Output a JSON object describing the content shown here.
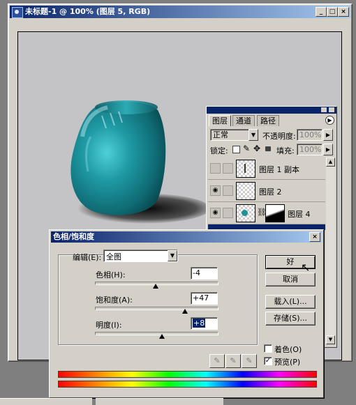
{
  "document": {
    "title": "未标题-1 @ 100% (图层 5, RGB)",
    "controls": {
      "minimize": "_",
      "maximize": "□",
      "close": "×"
    }
  },
  "layers_panel": {
    "tabs": [
      "图层",
      "通道",
      "路径"
    ],
    "blend_mode": "正常",
    "opacity_label": "不透明度:",
    "opacity_value": "100%",
    "lock_label": "锁定:",
    "fill_label": "填充:",
    "fill_value": "100%",
    "layers": [
      {
        "name": "图层 1 副本",
        "visible": false
      },
      {
        "name": "图层 2",
        "visible": true
      },
      {
        "name": "图层 4",
        "visible": true
      }
    ]
  },
  "dialog": {
    "title": "色相/饱和度",
    "edit_label": "编辑(E):",
    "edit_value": "全图",
    "hue_label": "色相(H):",
    "hue_value": "-4",
    "hue_position": 0.49,
    "saturation_label": "饱和度(A):",
    "saturation_value": "+47",
    "saturation_position": 0.73,
    "lightness_label": "明度(I):",
    "lightness_value": "+8",
    "lightness_position": 0.54,
    "buttons": {
      "ok": "好",
      "cancel": "取消",
      "load": "载入(L)...",
      "save": "存储(S)..."
    },
    "colorize_label": "着色(O)",
    "colorize_checked": false,
    "preview_label": "预览(P)",
    "preview_checked": true
  },
  "colors": {
    "title_bar_start": "#0a246a",
    "title_bar_end": "#a6caf0",
    "vase": "#1f8f99",
    "canvas": "#c4c4c6"
  }
}
